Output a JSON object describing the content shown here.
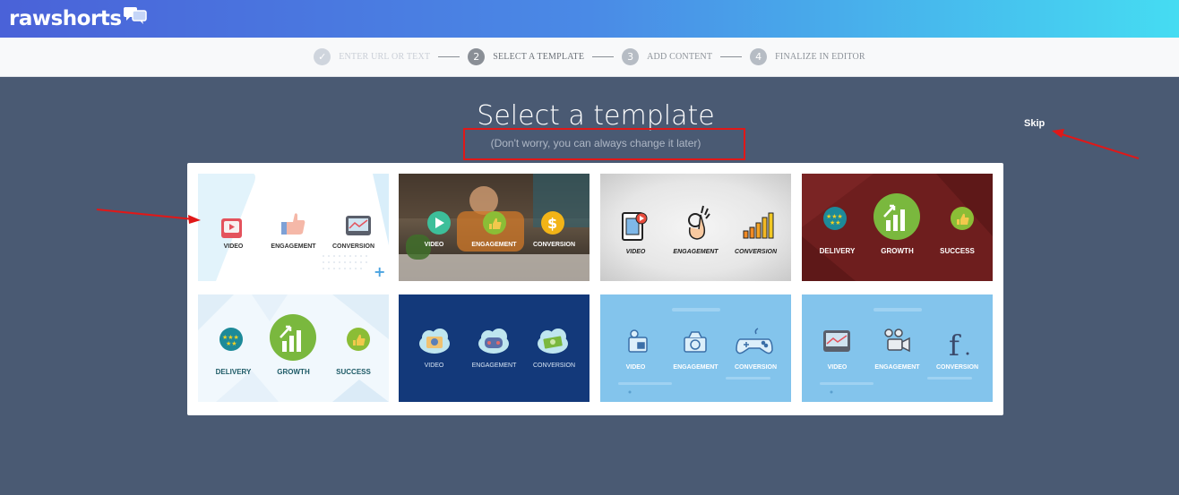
{
  "brand": {
    "name": "rawshorts"
  },
  "stepper": {
    "steps": [
      {
        "number": "✓",
        "label": "ENTER URL OR TEXT",
        "state": "done"
      },
      {
        "number": "2",
        "label": "SELECT A TEMPLATE",
        "state": "active"
      },
      {
        "number": "3",
        "label": "ADD CONTENT",
        "state": "todo"
      },
      {
        "number": "4",
        "label": "FINALIZE IN EDITOR",
        "state": "todo"
      }
    ]
  },
  "page": {
    "title": "Select a template",
    "subtitle": "(Don't worry, you can always change it later)",
    "skip_label": "Skip"
  },
  "templates": [
    {
      "labels": [
        "VIDEO",
        "ENGAGEMENT",
        "CONVERSION"
      ],
      "icons": [
        "play-button-icon",
        "thumbs-up-icon",
        "chart-screen-icon"
      ]
    },
    {
      "labels": [
        "VIDEO",
        "ENGAGEMENT",
        "CONVERSION"
      ],
      "icons": [
        "play-circle-icon",
        "thumbs-up-circle-icon",
        "dollar-circle-icon"
      ]
    },
    {
      "labels": [
        "VIDEO",
        "ENGAGEMENT",
        "CONVERSION"
      ],
      "icons": [
        "film-strip-icon",
        "ok-hand-icon",
        "bar-chart-icon"
      ]
    },
    {
      "labels": [
        "DELIVERY",
        "GROWTH",
        "SUCCESS"
      ],
      "icons": [
        "stars-circle-icon",
        "growth-chart-icon",
        "thumbs-up-circle-icon"
      ]
    },
    {
      "labels": [
        "DELIVERY",
        "GROWTH",
        "SUCCESS"
      ],
      "icons": [
        "stars-circle-icon",
        "growth-chart-icon",
        "thumbs-up-circle-icon"
      ]
    },
    {
      "labels": [
        "VIDEO",
        "ENGAGEMENT",
        "CONVERSION"
      ],
      "icons": [
        "cloud-camera-icon",
        "cloud-gamepad-icon",
        "cloud-money-icon"
      ]
    },
    {
      "labels": [
        "VIDEO",
        "ENGAGEMENT",
        "CONVERSION"
      ],
      "icons": [
        "projector-icon",
        "camera-icon",
        "gamepad-icon"
      ]
    },
    {
      "labels": [
        "VIDEO",
        "ENGAGEMENT",
        "CONVERSION"
      ],
      "icons": [
        "chart-screen-icon",
        "video-camera-icon",
        "facebook-icon"
      ]
    }
  ],
  "colors": {
    "header_start": "#4a62d8",
    "header_end": "#45dcf2",
    "background": "#4a5a73",
    "annotation": "#e01818"
  }
}
